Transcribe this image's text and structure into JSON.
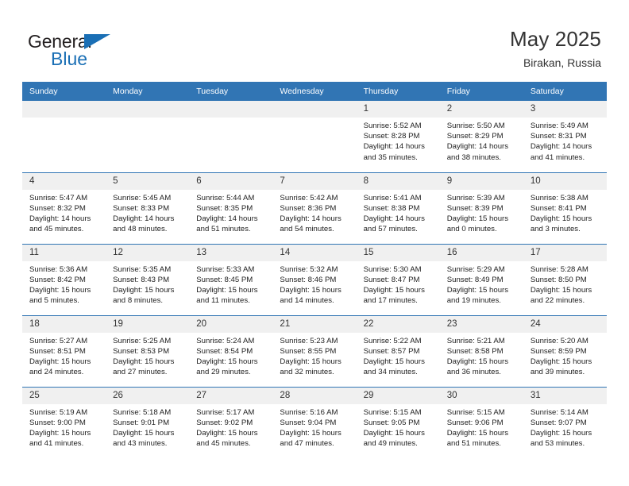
{
  "brand": {
    "name_top": "General",
    "name_bottom": "Blue",
    "triangle_color": "#1a6fb5",
    "top_color": "#231f20"
  },
  "header": {
    "title": "May 2025",
    "location": "Birakan, Russia",
    "header_bg": "#3175b4",
    "daynum_bg": "#f0f0f0"
  },
  "weekdays": [
    "Sunday",
    "Monday",
    "Tuesday",
    "Wednesday",
    "Thursday",
    "Friday",
    "Saturday"
  ],
  "weeks": [
    [
      {
        "day": "",
        "sunrise": "",
        "sunset": "",
        "daylight1": "",
        "daylight2": ""
      },
      {
        "day": "",
        "sunrise": "",
        "sunset": "",
        "daylight1": "",
        "daylight2": ""
      },
      {
        "day": "",
        "sunrise": "",
        "sunset": "",
        "daylight1": "",
        "daylight2": ""
      },
      {
        "day": "",
        "sunrise": "",
        "sunset": "",
        "daylight1": "",
        "daylight2": ""
      },
      {
        "day": "1",
        "sunrise": "Sunrise: 5:52 AM",
        "sunset": "Sunset: 8:28 PM",
        "daylight1": "Daylight: 14 hours",
        "daylight2": "and 35 minutes."
      },
      {
        "day": "2",
        "sunrise": "Sunrise: 5:50 AM",
        "sunset": "Sunset: 8:29 PM",
        "daylight1": "Daylight: 14 hours",
        "daylight2": "and 38 minutes."
      },
      {
        "day": "3",
        "sunrise": "Sunrise: 5:49 AM",
        "sunset": "Sunset: 8:31 PM",
        "daylight1": "Daylight: 14 hours",
        "daylight2": "and 41 minutes."
      }
    ],
    [
      {
        "day": "4",
        "sunrise": "Sunrise: 5:47 AM",
        "sunset": "Sunset: 8:32 PM",
        "daylight1": "Daylight: 14 hours",
        "daylight2": "and 45 minutes."
      },
      {
        "day": "5",
        "sunrise": "Sunrise: 5:45 AM",
        "sunset": "Sunset: 8:33 PM",
        "daylight1": "Daylight: 14 hours",
        "daylight2": "and 48 minutes."
      },
      {
        "day": "6",
        "sunrise": "Sunrise: 5:44 AM",
        "sunset": "Sunset: 8:35 PM",
        "daylight1": "Daylight: 14 hours",
        "daylight2": "and 51 minutes."
      },
      {
        "day": "7",
        "sunrise": "Sunrise: 5:42 AM",
        "sunset": "Sunset: 8:36 PM",
        "daylight1": "Daylight: 14 hours",
        "daylight2": "and 54 minutes."
      },
      {
        "day": "8",
        "sunrise": "Sunrise: 5:41 AM",
        "sunset": "Sunset: 8:38 PM",
        "daylight1": "Daylight: 14 hours",
        "daylight2": "and 57 minutes."
      },
      {
        "day": "9",
        "sunrise": "Sunrise: 5:39 AM",
        "sunset": "Sunset: 8:39 PM",
        "daylight1": "Daylight: 15 hours",
        "daylight2": "and 0 minutes."
      },
      {
        "day": "10",
        "sunrise": "Sunrise: 5:38 AM",
        "sunset": "Sunset: 8:41 PM",
        "daylight1": "Daylight: 15 hours",
        "daylight2": "and 3 minutes."
      }
    ],
    [
      {
        "day": "11",
        "sunrise": "Sunrise: 5:36 AM",
        "sunset": "Sunset: 8:42 PM",
        "daylight1": "Daylight: 15 hours",
        "daylight2": "and 5 minutes."
      },
      {
        "day": "12",
        "sunrise": "Sunrise: 5:35 AM",
        "sunset": "Sunset: 8:43 PM",
        "daylight1": "Daylight: 15 hours",
        "daylight2": "and 8 minutes."
      },
      {
        "day": "13",
        "sunrise": "Sunrise: 5:33 AM",
        "sunset": "Sunset: 8:45 PM",
        "daylight1": "Daylight: 15 hours",
        "daylight2": "and 11 minutes."
      },
      {
        "day": "14",
        "sunrise": "Sunrise: 5:32 AM",
        "sunset": "Sunset: 8:46 PM",
        "daylight1": "Daylight: 15 hours",
        "daylight2": "and 14 minutes."
      },
      {
        "day": "15",
        "sunrise": "Sunrise: 5:30 AM",
        "sunset": "Sunset: 8:47 PM",
        "daylight1": "Daylight: 15 hours",
        "daylight2": "and 17 minutes."
      },
      {
        "day": "16",
        "sunrise": "Sunrise: 5:29 AM",
        "sunset": "Sunset: 8:49 PM",
        "daylight1": "Daylight: 15 hours",
        "daylight2": "and 19 minutes."
      },
      {
        "day": "17",
        "sunrise": "Sunrise: 5:28 AM",
        "sunset": "Sunset: 8:50 PM",
        "daylight1": "Daylight: 15 hours",
        "daylight2": "and 22 minutes."
      }
    ],
    [
      {
        "day": "18",
        "sunrise": "Sunrise: 5:27 AM",
        "sunset": "Sunset: 8:51 PM",
        "daylight1": "Daylight: 15 hours",
        "daylight2": "and 24 minutes."
      },
      {
        "day": "19",
        "sunrise": "Sunrise: 5:25 AM",
        "sunset": "Sunset: 8:53 PM",
        "daylight1": "Daylight: 15 hours",
        "daylight2": "and 27 minutes."
      },
      {
        "day": "20",
        "sunrise": "Sunrise: 5:24 AM",
        "sunset": "Sunset: 8:54 PM",
        "daylight1": "Daylight: 15 hours",
        "daylight2": "and 29 minutes."
      },
      {
        "day": "21",
        "sunrise": "Sunrise: 5:23 AM",
        "sunset": "Sunset: 8:55 PM",
        "daylight1": "Daylight: 15 hours",
        "daylight2": "and 32 minutes."
      },
      {
        "day": "22",
        "sunrise": "Sunrise: 5:22 AM",
        "sunset": "Sunset: 8:57 PM",
        "daylight1": "Daylight: 15 hours",
        "daylight2": "and 34 minutes."
      },
      {
        "day": "23",
        "sunrise": "Sunrise: 5:21 AM",
        "sunset": "Sunset: 8:58 PM",
        "daylight1": "Daylight: 15 hours",
        "daylight2": "and 36 minutes."
      },
      {
        "day": "24",
        "sunrise": "Sunrise: 5:20 AM",
        "sunset": "Sunset: 8:59 PM",
        "daylight1": "Daylight: 15 hours",
        "daylight2": "and 39 minutes."
      }
    ],
    [
      {
        "day": "25",
        "sunrise": "Sunrise: 5:19 AM",
        "sunset": "Sunset: 9:00 PM",
        "daylight1": "Daylight: 15 hours",
        "daylight2": "and 41 minutes."
      },
      {
        "day": "26",
        "sunrise": "Sunrise: 5:18 AM",
        "sunset": "Sunset: 9:01 PM",
        "daylight1": "Daylight: 15 hours",
        "daylight2": "and 43 minutes."
      },
      {
        "day": "27",
        "sunrise": "Sunrise: 5:17 AM",
        "sunset": "Sunset: 9:02 PM",
        "daylight1": "Daylight: 15 hours",
        "daylight2": "and 45 minutes."
      },
      {
        "day": "28",
        "sunrise": "Sunrise: 5:16 AM",
        "sunset": "Sunset: 9:04 PM",
        "daylight1": "Daylight: 15 hours",
        "daylight2": "and 47 minutes."
      },
      {
        "day": "29",
        "sunrise": "Sunrise: 5:15 AM",
        "sunset": "Sunset: 9:05 PM",
        "daylight1": "Daylight: 15 hours",
        "daylight2": "and 49 minutes."
      },
      {
        "day": "30",
        "sunrise": "Sunrise: 5:15 AM",
        "sunset": "Sunset: 9:06 PM",
        "daylight1": "Daylight: 15 hours",
        "daylight2": "and 51 minutes."
      },
      {
        "day": "31",
        "sunrise": "Sunrise: 5:14 AM",
        "sunset": "Sunset: 9:07 PM",
        "daylight1": "Daylight: 15 hours",
        "daylight2": "and 53 minutes."
      }
    ]
  ]
}
